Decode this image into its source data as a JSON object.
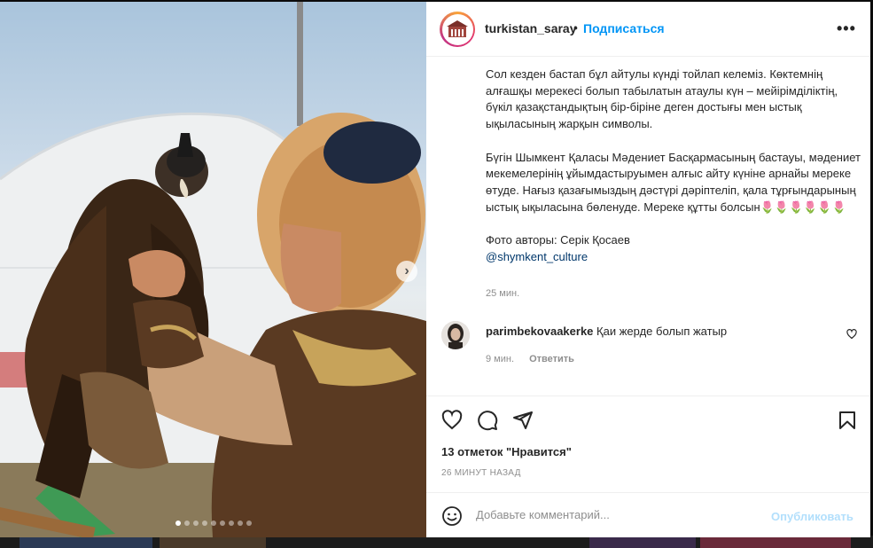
{
  "post": {
    "username": "turkistan_saray",
    "separator": "•",
    "follow_label": "Подписаться",
    "more_label": "•••",
    "caption": {
      "p1": "Сол кезден бастап бұл айтулы күнді тойлап келеміз. Көктемнің алғашқы мерекесі болып табылатын атаулы күн – мейірімділіктің, бүкіл қазақстандықтың бір-біріне деген достығы мен ыстық ықыласының жарқын символы.",
      "p2": "Бүгін Шымкент Қаласы Мәдениет Басқармасының бастауы, мәдениет мекемелерінің ұйымдастыруымен алғыс айту күніне арнайы мереке өтуде. Нағыз қазағымыздың дәстүрі дәріптеліп, қала тұрғындарының ыстық ықыласына бөленуде. Мереке құтты болсын🌷🌷🌷🌷🌷🌷",
      "photo_credit": "Фото авторы: Серік Қосаев",
      "mention": "@shymkent_culture"
    },
    "caption_time": "25 мин.",
    "likes_text": "13 отметок \"Нравится\"",
    "time_ago": "26 МИНУТ НАЗАД"
  },
  "comments": [
    {
      "username": "parimbekovaakerke",
      "text": "Қаи жерде болып жатыр",
      "time": "9 мин.",
      "reply_label": "Ответить"
    }
  ],
  "composer": {
    "placeholder": "Добавьте комментарий...",
    "publish_label": "Опубликовать"
  },
  "carousel": {
    "slide_count": 9,
    "active_index": 0
  },
  "colors": {
    "accent": "#0095f6",
    "publish_disabled": "#b2dffc",
    "text": "#262626",
    "muted": "#8e8e8e"
  },
  "icons": [
    "heart-icon",
    "comment-icon",
    "share-icon",
    "bookmark-icon",
    "emoji-icon",
    "chevron-right-icon",
    "more-icon"
  ]
}
